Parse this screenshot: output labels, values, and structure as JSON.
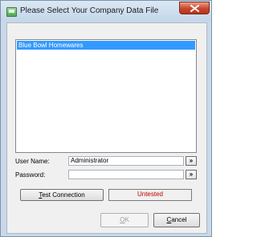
{
  "window": {
    "title": "Please Select Your Company Data File"
  },
  "company_list": {
    "items": [
      "Blue Bowl Homewares"
    ],
    "selected_index": 0
  },
  "form": {
    "user_name_label": "User Name:",
    "user_name_value": "Administrator",
    "password_label": "Password:",
    "password_value": "",
    "browse_glyph": "»"
  },
  "connection": {
    "test_label_prefix": "",
    "test_label_key": "T",
    "test_label_rest": "est Connection",
    "status": "Untested",
    "status_color": "#c00000"
  },
  "buttons": {
    "ok_key": "O",
    "ok_rest": "K",
    "cancel_key": "C",
    "cancel_rest": "ancel"
  },
  "colors": {
    "selection": "#3399ff",
    "close_button": "#c8452a"
  }
}
